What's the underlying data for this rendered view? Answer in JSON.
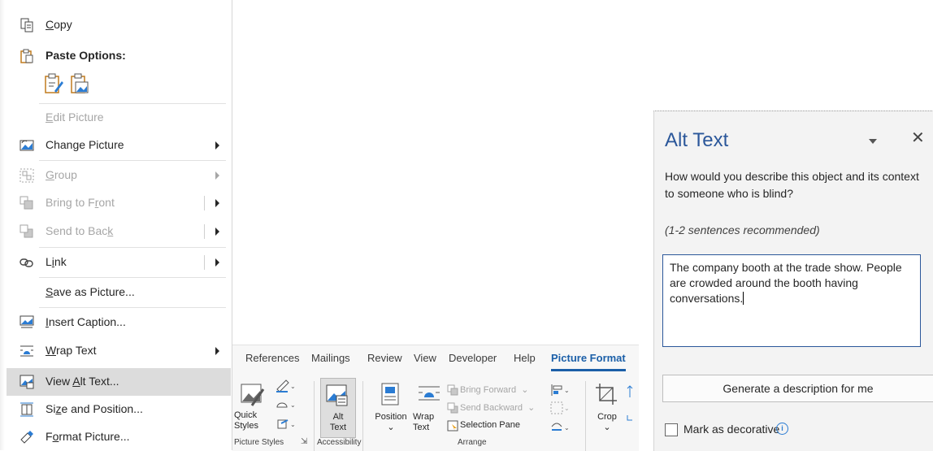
{
  "context_menu": {
    "items": [
      {
        "label": "Copy",
        "mnemonic": "C",
        "rest": "opy",
        "icon": "copy-icon",
        "enabled": true
      },
      {
        "label": "Paste Options:",
        "icon": "paste-icon",
        "enabled": true,
        "bold": true
      },
      {
        "label": "Edit Picture",
        "enabled": false
      },
      {
        "label": "Change Picture",
        "pre": "Chan",
        "mnemonic": "g",
        "rest": "e Picture",
        "icon": "change-picture-icon",
        "enabled": true,
        "submenu": true
      },
      {
        "label": "Group",
        "mnemonic": "G",
        "rest": "roup",
        "icon": "group-icon",
        "enabled": false,
        "submenu": true
      },
      {
        "label": "Bring to Front",
        "pre": "Bring to F",
        "mnemonic": "r",
        "rest": "ont",
        "icon": "bring-to-front-icon",
        "enabled": false,
        "submenu": true
      },
      {
        "label": "Send to Back",
        "pre": "Send to Bac",
        "mnemonic": "k",
        "rest": "",
        "icon": "send-to-back-icon",
        "enabled": false,
        "submenu": true
      },
      {
        "label": "Link",
        "pre": "L",
        "mnemonic": "i",
        "rest": "nk",
        "icon": "link-icon",
        "enabled": true,
        "submenu": true
      },
      {
        "label": "Save as Picture...",
        "mnemonic": "S",
        "rest": "ave as Picture...",
        "enabled": true
      },
      {
        "label": "Insert Caption...",
        "mnemonic": "I",
        "rest": "nsert Caption...",
        "icon": "insert-caption-icon",
        "enabled": true
      },
      {
        "label": "Wrap Text",
        "mnemonic": "W",
        "rest": "rap Text",
        "icon": "wrap-text-icon",
        "enabled": true,
        "submenu": true
      },
      {
        "label": "View Alt Text...",
        "pre": "View ",
        "mnemonic": "A",
        "rest": "lt Text...",
        "icon": "alt-text-icon",
        "enabled": true,
        "highlighted": true
      },
      {
        "label": "Size and Position...",
        "pre": "Si",
        "mnemonic": "z",
        "rest": "e and Position...",
        "icon": "size-position-icon",
        "enabled": true
      },
      {
        "label": "Format Picture...",
        "pre": "F",
        "mnemonic": "o",
        "rest": "rmat Picture...",
        "icon": "format-picture-icon",
        "enabled": true
      }
    ]
  },
  "ribbon": {
    "tabs": [
      "References",
      "Mailings",
      "Review",
      "View",
      "Developer",
      "Help",
      "Picture Format"
    ],
    "active_tab": "Picture Format",
    "quick_styles": "Quick\nStyles",
    "alt_text": "Alt\nText",
    "position": "Position",
    "wrap_text": "Wrap\nText",
    "bring_forward": "Bring Forward",
    "send_backward": "Send Backward",
    "selection_pane": "Selection Pane",
    "crop": "Crop",
    "groups": {
      "picture_styles": "Picture Styles",
      "accessibility": "Accessibility",
      "arrange": "Arrange"
    }
  },
  "alt_text_pane": {
    "title": "Alt Text",
    "description": "How would you describe this object and its context to someone who is blind?",
    "hint": "(1-2 sentences recommended)",
    "text_value": "The company booth at the trade show. People are crowded around the booth having conversations.",
    "generate_button": "Generate a description for me",
    "decorative_label": "Mark as decorative",
    "decorative_checked": false,
    "accent_color": "#2b579a"
  }
}
